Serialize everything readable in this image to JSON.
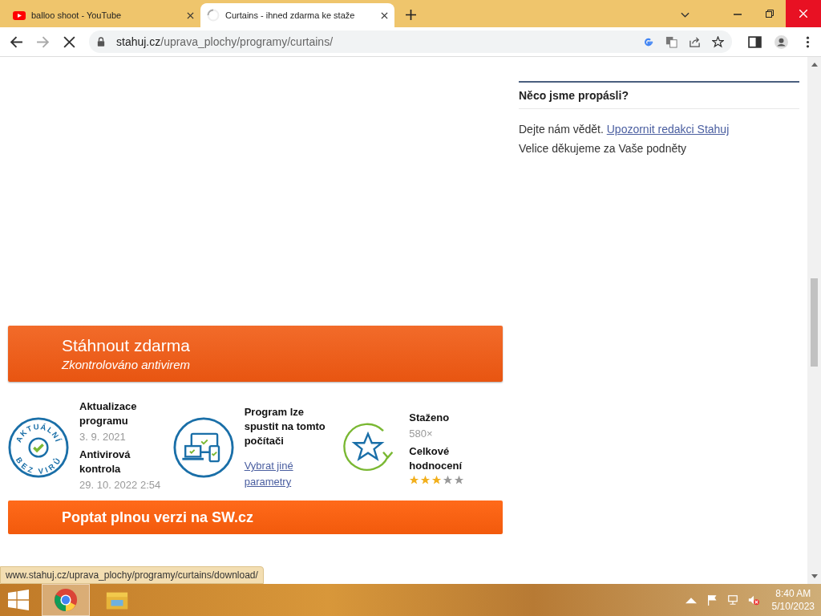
{
  "browser": {
    "tabs": [
      {
        "title": "balloo shoot - YouTube",
        "selected": false,
        "loading": false
      },
      {
        "title": "Curtains - ihned zdarma ke staže",
        "selected": true,
        "loading": true
      }
    ],
    "address": {
      "domain": "stahuj.cz",
      "path": "/uprava_plochy/programy/curtains/"
    },
    "loading": true
  },
  "download_button": {
    "title": "Stáhnout zdarma",
    "subtitle": "Zkontrolováno antivirem"
  },
  "info": {
    "update": {
      "badge_top": "AKTUÁLNÍ",
      "badge_bottom": "BEZ VIRŮ",
      "label": "Aktualizace programu",
      "date": "3. 9. 2021",
      "antivirus_label": "Antivirová kontrola",
      "antivirus_date": "29. 10. 2022 2:54"
    },
    "compat": {
      "text": "Program lze spustit na tomto počítači",
      "link": "Vybrat jiné parametry"
    },
    "stats": {
      "downloads_label": "Staženo",
      "downloads": "580×",
      "rating_label": "Celkové hodnocení",
      "stars": 3
    }
  },
  "sw_button": "Poptat plnou verzi na SW.cz",
  "sidebar": {
    "title": "Něco jsme propásli?",
    "text": "Dejte nám vědět.",
    "link": "Upozornit redakci Stahuj",
    "thanks": "Velice děkujeme za Vaše podněty"
  },
  "status_bubble": "www.stahuj.cz/uprava_plochy/programy/curtains/download/",
  "taskbar": {
    "time": "8:40 AM",
    "date": "5/10/2023"
  }
}
